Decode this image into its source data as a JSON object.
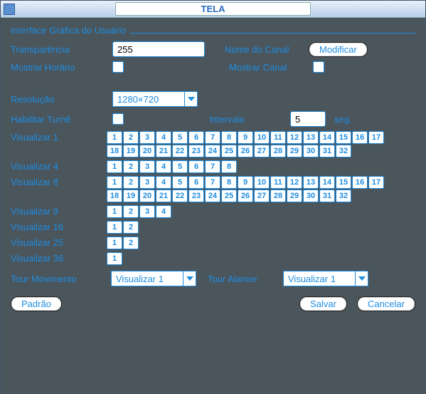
{
  "window": {
    "title": "TELA"
  },
  "section": {
    "title": "Interface Gráfica do Usuário"
  },
  "labels": {
    "transparency": "Transparência",
    "channel_name": "Nome do Canal",
    "modify": "Modificar",
    "show_time": "Mostrar Horário",
    "show_channel": "Mostrar Canal",
    "resolution": "Resolução",
    "enable_tour": "Habilitar Turnê",
    "interval": "Intervalo",
    "interval_unit": "seg.",
    "view1": "Visualizar 1",
    "view4": "Visualizar 4",
    "view8": "Visualizar 8",
    "view9": "Visualizar 9",
    "view16": "Visualizar 16",
    "view25": "Visualizar 25",
    "view36": "Visualizar 36",
    "tour_motion": "Tour Movimento",
    "tour_alarm": "Tour Alarme",
    "default": "Padrão",
    "save": "Salvar",
    "cancel": "Cancelar"
  },
  "values": {
    "transparency": "255",
    "resolution": "1280×720",
    "interval": "5",
    "tour_motion": "Visualizar 1",
    "tour_alarm": "Visualizar 1"
  },
  "grids": {
    "view1": [
      "1",
      "2",
      "3",
      "4",
      "5",
      "6",
      "7",
      "8",
      "9",
      "10",
      "11",
      "12",
      "13",
      "14",
      "15",
      "16",
      "17",
      "18",
      "19",
      "20",
      "21",
      "22",
      "23",
      "24",
      "25",
      "26",
      "27",
      "28",
      "29",
      "30",
      "31",
      "32"
    ],
    "view4": [
      "1",
      "2",
      "3",
      "4",
      "5",
      "6",
      "7",
      "8"
    ],
    "view8": [
      "1",
      "2",
      "3",
      "4",
      "5",
      "6",
      "7",
      "8",
      "9",
      "10",
      "11",
      "12",
      "13",
      "14",
      "15",
      "16",
      "17",
      "18",
      "19",
      "20",
      "21",
      "22",
      "23",
      "24",
      "25",
      "26",
      "27",
      "28",
      "29",
      "30",
      "31",
      "32"
    ],
    "view9": [
      "1",
      "2",
      "3",
      "4"
    ],
    "view16": [
      "1",
      "2"
    ],
    "view25": [
      "1",
      "2"
    ],
    "view36": [
      "1"
    ]
  }
}
